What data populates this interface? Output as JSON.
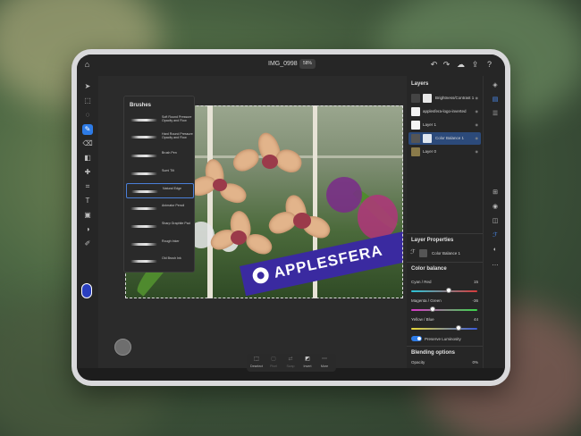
{
  "document": {
    "title": "IMG_0998",
    "zoom": "58%"
  },
  "brushes_popup": {
    "title": "Brushes",
    "items": [
      {
        "label": "Soft Round Pressure Opacity and Flow"
      },
      {
        "label": "Hard Round Pressure Opacity and Flow"
      },
      {
        "label": "Brush Pen"
      },
      {
        "label": "Sumi Tilt"
      },
      {
        "label": "Natural Edge",
        "selected": true
      },
      {
        "label": "Animator Pencil"
      },
      {
        "label": "Sharp Graphite Pad"
      },
      {
        "label": "Rough Inker"
      },
      {
        "label": "Old Brush Ink"
      }
    ]
  },
  "watermark": {
    "text": "APPLESFERA"
  },
  "layers_panel": {
    "title": "Layers",
    "layers": [
      {
        "name": "Brightness/Contrast 1",
        "thumb_color": "#e8e8e8"
      },
      {
        "name": "applesfera-logo-inverted",
        "thumb_color": "#f2f2f2"
      },
      {
        "name": "Layer 1",
        "thumb_color": "#f5f5f5"
      },
      {
        "name": "Color Balance 1",
        "thumb_color": "#dfe6f0",
        "selected": true
      },
      {
        "name": "Layer 0",
        "thumb_color": "#8a7a4a"
      }
    ]
  },
  "layer_properties": {
    "title": "Layer Properties",
    "layer_name": "Color Balance 1"
  },
  "color_balance": {
    "title": "Color balance",
    "sliders": [
      {
        "label": "Cyan / Red",
        "value": "15",
        "fraction": 0.57
      },
      {
        "label": "Magenta / Green",
        "value": "-36",
        "fraction": 0.32
      },
      {
        "label": "Yellow / Blue",
        "value": "44",
        "fraction": 0.72
      }
    ],
    "preserve_luminosity_label": "Preserve Luminosity",
    "preserve_luminosity_on": true
  },
  "blending": {
    "title": "Blending options",
    "opacity_label": "Opacity",
    "opacity_value": "0%"
  },
  "dock": {
    "items": [
      {
        "label": "Deselect",
        "icon": "deselect-icon",
        "enabled": true
      },
      {
        "label": "Pixel",
        "icon": "pixel-icon",
        "enabled": false
      },
      {
        "label": "Swap",
        "icon": "swap-icon",
        "enabled": false
      },
      {
        "label": "Invert",
        "icon": "invert-icon",
        "enabled": true
      },
      {
        "label": "More",
        "icon": "more-icon",
        "enabled": true
      }
    ]
  },
  "colors": {
    "accent": "#2d7be6",
    "foreground_color": "#2a3fbf",
    "banner": "#3a2aa0"
  }
}
